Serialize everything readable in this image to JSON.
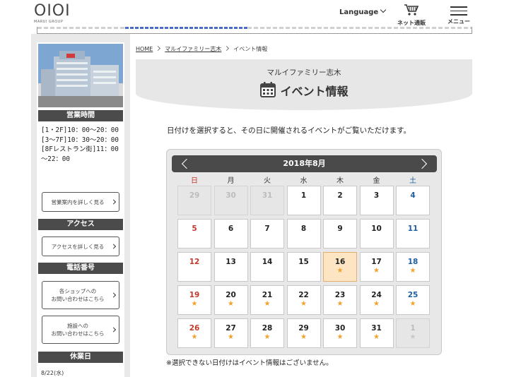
{
  "header": {
    "logo_mark": "OIOI",
    "logo_sub": "MARUI GROUP",
    "language": "Language",
    "cart_label": "ネット通販",
    "menu_label": "メニュー"
  },
  "sidebar": {
    "hours_title": "営業時間",
    "hours_text": "[1・2F]10：00～20：00\n[3～7F]10：30～20：00\n[8Fレストラン街]11：00～22：00",
    "hours_button": "営業案内を詳しく見る",
    "access_title": "アクセス",
    "access_button": "アクセスを詳しく見る",
    "phone_title": "電話番号",
    "shop_button_line1": "各ショップへの",
    "shop_button_line2": "お問い合わせはこちら",
    "facility_button_line1": "施設への",
    "facility_button_line2": "お問い合わせはこちら",
    "closed_title": "休業日",
    "closed_date": "8/22(水)"
  },
  "breadcrumb": {
    "home": "HOME",
    "store": "マルイファミリー志木",
    "current": "イベント情報"
  },
  "page": {
    "store_name": "マルイファミリー志木",
    "title": "イベント情報",
    "intro": "日付けを選択すると、その日に開催されるイベントがご覧いただけます。",
    "footnote": "※選択できない日付けはイベント情報はございません。"
  },
  "calendar": {
    "month": "2018年8月",
    "weekdays": [
      "日",
      "月",
      "火",
      "水",
      "木",
      "金",
      "土"
    ],
    "star": "★",
    "weeks": [
      [
        {
          "d": "29",
          "off": true,
          "ev": false
        },
        {
          "d": "30",
          "off": true,
          "ev": false
        },
        {
          "d": "31",
          "off": true,
          "ev": false
        },
        {
          "d": "1",
          "off": false,
          "ev": false
        },
        {
          "d": "2",
          "off": false,
          "ev": false
        },
        {
          "d": "3",
          "off": false,
          "ev": false
        },
        {
          "d": "4",
          "off": false,
          "ev": false
        }
      ],
      [
        {
          "d": "5",
          "off": false,
          "ev": false
        },
        {
          "d": "6",
          "off": false,
          "ev": false
        },
        {
          "d": "7",
          "off": false,
          "ev": false
        },
        {
          "d": "8",
          "off": false,
          "ev": false
        },
        {
          "d": "9",
          "off": false,
          "ev": false
        },
        {
          "d": "10",
          "off": false,
          "ev": false
        },
        {
          "d": "11",
          "off": false,
          "ev": false
        }
      ],
      [
        {
          "d": "12",
          "off": false,
          "ev": false
        },
        {
          "d": "13",
          "off": false,
          "ev": false
        },
        {
          "d": "14",
          "off": false,
          "ev": false
        },
        {
          "d": "15",
          "off": false,
          "ev": false
        },
        {
          "d": "16",
          "off": false,
          "ev": true,
          "sel": true
        },
        {
          "d": "17",
          "off": false,
          "ev": true
        },
        {
          "d": "18",
          "off": false,
          "ev": true
        }
      ],
      [
        {
          "d": "19",
          "off": false,
          "ev": true
        },
        {
          "d": "20",
          "off": false,
          "ev": true
        },
        {
          "d": "21",
          "off": false,
          "ev": true
        },
        {
          "d": "22",
          "off": false,
          "ev": true
        },
        {
          "d": "23",
          "off": false,
          "ev": true
        },
        {
          "d": "24",
          "off": false,
          "ev": true
        },
        {
          "d": "25",
          "off": false,
          "ev": true
        }
      ],
      [
        {
          "d": "26",
          "off": false,
          "ev": true
        },
        {
          "d": "27",
          "off": false,
          "ev": true
        },
        {
          "d": "28",
          "off": false,
          "ev": true
        },
        {
          "d": "29",
          "off": false,
          "ev": true
        },
        {
          "d": "30",
          "off": false,
          "ev": true
        },
        {
          "d": "31",
          "off": false,
          "ev": true
        },
        {
          "d": "1",
          "off": true,
          "ev": true
        }
      ]
    ]
  },
  "colors": {
    "sunday": "#c0392b",
    "saturday": "#1f5fa0",
    "star": "#f0a22c",
    "selected_bg": "#fde5c3",
    "header_dark": "#4a4a4a"
  }
}
